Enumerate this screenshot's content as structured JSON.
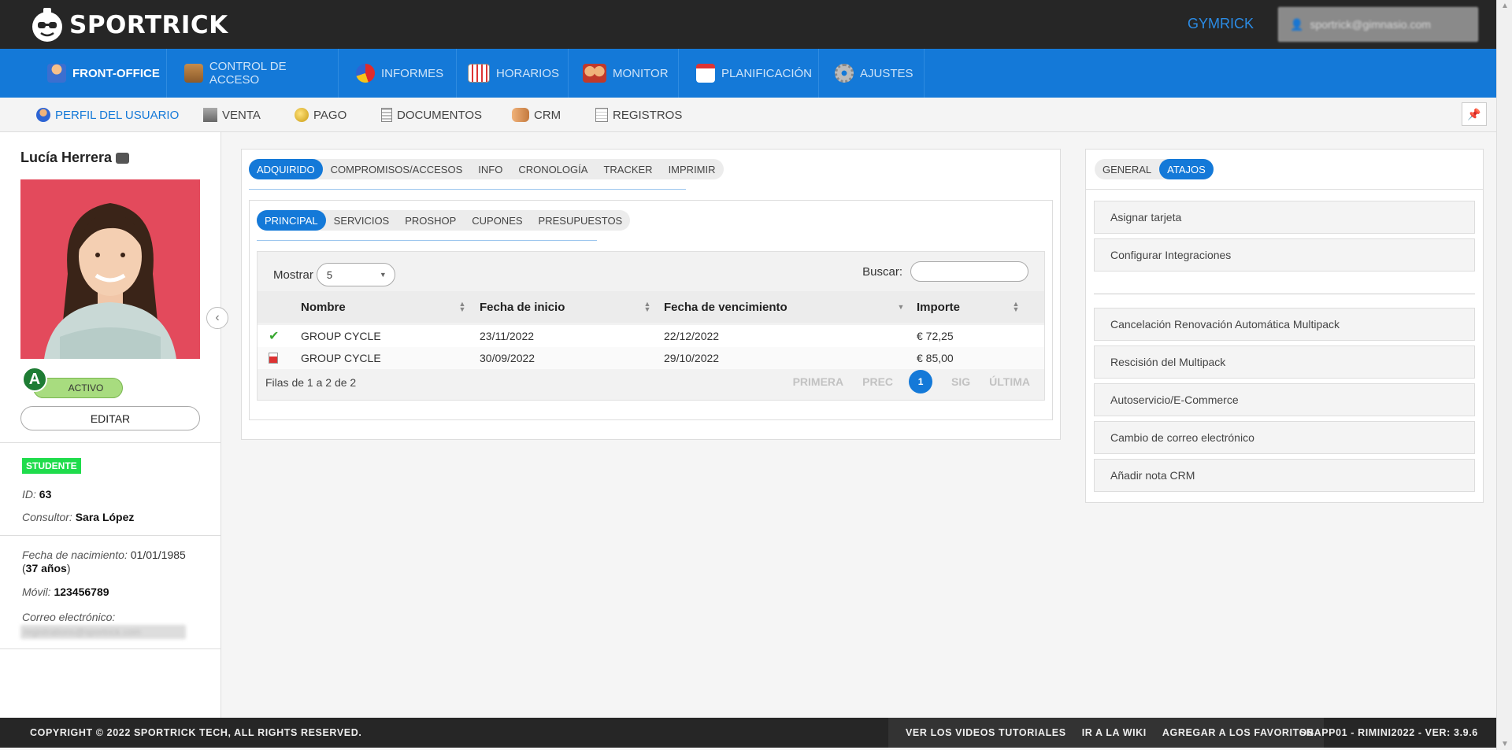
{
  "header": {
    "brand": "SPORTRICK",
    "gym": "GYMRICK",
    "user_email": "sportrick@gimnasio.com"
  },
  "main_nav": [
    {
      "label": "FRONT-OFFICE",
      "icon": "user-icon"
    },
    {
      "label": "CONTROL DE ACCESO",
      "icon": "door-icon"
    },
    {
      "label": "INFORMES",
      "icon": "pie-chart-icon"
    },
    {
      "label": "HORARIOS",
      "icon": "calendar-icon"
    },
    {
      "label": "MONITOR",
      "icon": "people-icon"
    },
    {
      "label": "PLANIFICACIÓN",
      "icon": "planner-icon"
    },
    {
      "label": "AJUSTES",
      "icon": "gear-icon"
    }
  ],
  "sub_nav": [
    {
      "label": "PERFIL DEL USUARIO",
      "icon": "profile-icon"
    },
    {
      "label": "VENTA",
      "icon": "register-icon"
    },
    {
      "label": "PAGO",
      "icon": "coin-icon"
    },
    {
      "label": "DOCUMENTOS",
      "icon": "document-icon"
    },
    {
      "label": "CRM",
      "icon": "handshake-icon"
    },
    {
      "label": "REGISTROS",
      "icon": "notepad-icon"
    }
  ],
  "profile": {
    "name": "Lucía Herrera",
    "level_badge": "A",
    "status": "ACTIVO",
    "edit_label": "EDITAR",
    "tag": "STUDENTE",
    "id_label": "ID:",
    "id_value": "63",
    "consultant_label": "Consultor:",
    "consultant_value": "Sara López",
    "birth_label": "Fecha de nacimiento:",
    "birth_value": "01/01/1985",
    "age_open": "(",
    "age_value": "37 años",
    "age_close": ")",
    "mobile_label": "Móvil:",
    "mobile_value": "123456789",
    "email_label": "Correo electrónico:",
    "email_value": "registrations@sportrick.com"
  },
  "main_tabs": [
    "ADQUIRIDO",
    "COMPROMISOS/ACCESOS",
    "INFO",
    "CRONOLOGÍA",
    "TRACKER",
    "IMPRIMIR"
  ],
  "sub_tabs": [
    "PRINCIPAL",
    "SERVICIOS",
    "PROSHOP",
    "CUPONES",
    "PRESUPUESTOS"
  ],
  "table": {
    "show_label": "Mostrar",
    "page_size": "5",
    "search_label": "Buscar:",
    "columns": [
      "Nombre",
      "Fecha de inicio",
      "Fecha de vencimiento",
      "Importe"
    ],
    "rows": [
      {
        "status": "check-icon",
        "name": "GROUP CYCLE",
        "start": "23/11/2022",
        "end": "22/12/2022",
        "amount": "€ 72,25"
      },
      {
        "status": "expired-icon",
        "name": "GROUP CYCLE",
        "start": "30/09/2022",
        "end": "29/10/2022",
        "amount": "€ 85,00"
      }
    ],
    "info": "Filas de 1 a 2 de 2",
    "pager": {
      "first": "PRIMERA",
      "prev": "PREC",
      "current": "1",
      "next": "SIG",
      "last": "ÚLTIMA"
    }
  },
  "right_tabs": [
    "GENERAL",
    "ATAJOS"
  ],
  "shortcuts_top": [
    "Asignar tarjeta",
    "Configurar Integraciones"
  ],
  "shortcuts_bottom": [
    "Cancelación Renovación Automática Multipack",
    "Rescisión del Multipack",
    "Autoservicio/E-Commerce",
    "Cambio de correo electrónico",
    "Añadir nota CRM"
  ],
  "footer": {
    "copyright": "COPYRIGHT © 2022 SPORTRICK TECH, ALL RIGHTS RESERVED.",
    "links": [
      "VER LOS VIDEOS TUTORIALES",
      "IR A LA WIKI",
      "AGREGAR A LOS FAVORITOS"
    ],
    "version": "SRAPP01 - RIMINI2022 - VER: 3.9.6"
  },
  "colors": {
    "primary": "#1479d8",
    "dark": "#262626",
    "active_green": "#a8dc7f",
    "tag_green": "#1fdc4c"
  }
}
